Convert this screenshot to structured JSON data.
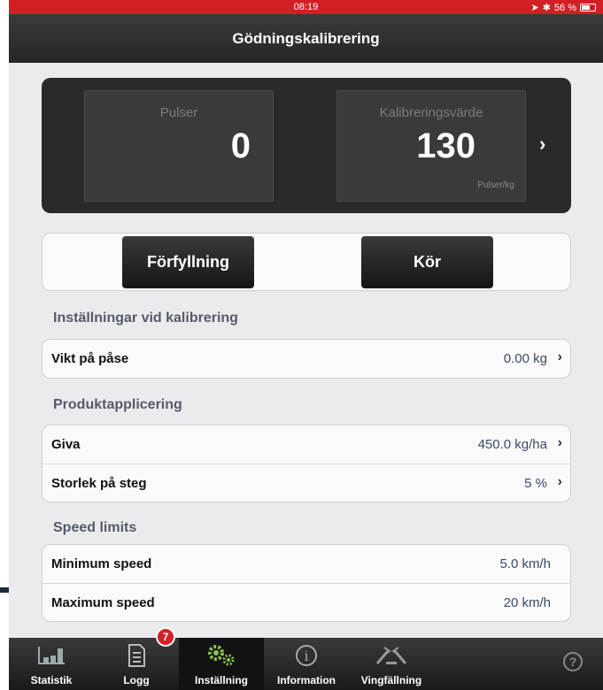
{
  "status": {
    "time": "08:19",
    "battery": "56 %"
  },
  "title": "Gödningskalibrering",
  "pulser": {
    "label": "Pulser",
    "value": "0"
  },
  "kalibrering": {
    "label": "Kalibreringsvärde",
    "value": "130",
    "unit": "Pulser/kg"
  },
  "buttons": {
    "prefill": "Förfyllning",
    "run": "Kör"
  },
  "sections": [
    {
      "title": "Inställningar vid kalibrering",
      "rows": [
        {
          "label": "Vikt på påse",
          "value": "0.00 kg"
        }
      ]
    },
    {
      "title": "Produktapplicering",
      "rows": [
        {
          "label": "Giva",
          "value": "450.0 kg/ha"
        },
        {
          "label": "Storlek på steg",
          "value": "5 %"
        }
      ]
    },
    {
      "title": "Speed limits",
      "rows": [
        {
          "label": "Minimum speed",
          "value": "5.0 km/h"
        },
        {
          "label": "Maximum speed",
          "value": "20 km/h"
        }
      ]
    }
  ],
  "tabs": [
    {
      "label": "Statistik",
      "icon": "bar-chart-icon"
    },
    {
      "label": "Logg",
      "icon": "document-icon",
      "badge": "7"
    },
    {
      "label": "Inställning",
      "icon": "gears-icon",
      "active": true
    },
    {
      "label": "Information",
      "icon": "info-icon"
    },
    {
      "label": "Vingfällning",
      "icon": "wing-fold-icon"
    }
  ],
  "help": "?",
  "colors": {
    "status_bar": "#d21f26",
    "accent": "#8bc34a",
    "value_text": "#3c4a68"
  }
}
